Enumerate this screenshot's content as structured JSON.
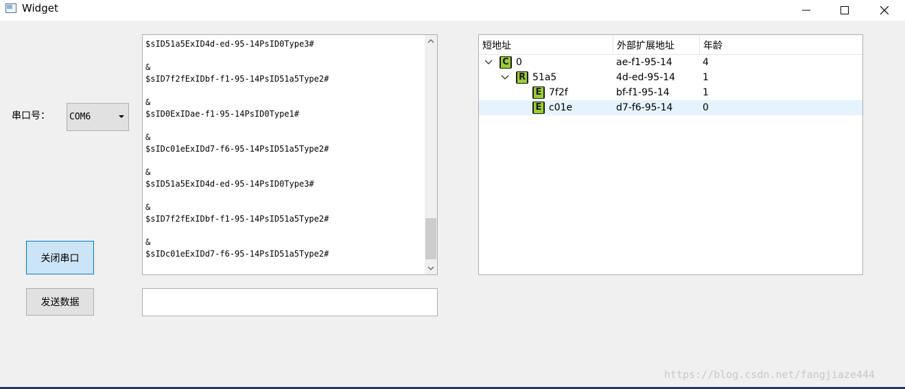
{
  "window": {
    "title": "Widget",
    "app_icon": "window-icon",
    "controls": [
      "minimize-icon",
      "maximize-icon",
      "close-icon"
    ]
  },
  "serial": {
    "port_label": "串口号：",
    "port_value": "COM6",
    "close_button": "关闭串口",
    "send_button": "发送数据",
    "send_input_value": ""
  },
  "log_lines": [
    "&",
    "$sID51a5ExID4d-ed-95-14PsID0Type3#",
    "",
    "&",
    "$sID7f2fExIDbf-f1-95-14PsID51a5Type2#",
    "",
    "&",
    "$sID0ExIDae-f1-95-14PsID0Type1#",
    "",
    "&",
    "$sIDc01eExIDd7-f6-95-14PsID51a5Type2#",
    "",
    "&",
    "$sID51a5ExID4d-ed-95-14PsID0Type3#",
    "",
    "&",
    "$sID7f2fExIDbf-f1-95-14PsID51a5Type2#",
    "",
    "&",
    "$sIDc01eExIDd7-f6-95-14PsID51a5Type2#"
  ],
  "log_scroll_position": 0.87,
  "tree": {
    "headers": [
      "短地址",
      "外部扩展地址",
      "年龄"
    ],
    "rows": [
      {
        "badge": "C",
        "short": "0",
        "ext": "ae-f1-95-14",
        "age": "4",
        "expanded": true,
        "selected": false
      },
      {
        "badge": "R",
        "short": "51a5",
        "ext": "4d-ed-95-14",
        "age": "1",
        "expanded": true,
        "selected": false
      },
      {
        "badge": "E",
        "short": "7f2f",
        "ext": "bf-f1-95-14",
        "age": "1",
        "expanded": false,
        "selected": false
      },
      {
        "badge": "E",
        "short": "c01e",
        "ext": "d7-f6-95-14",
        "age": "0",
        "expanded": false,
        "selected": true
      }
    ]
  },
  "watermark": "https://blog.csdn.net/fangjiaze444",
  "colors": {
    "badge_green": "#9acd32",
    "selected_row": "#e5f3ff",
    "focus_button": "#cce4f7",
    "focus_border": "#0078d7"
  }
}
